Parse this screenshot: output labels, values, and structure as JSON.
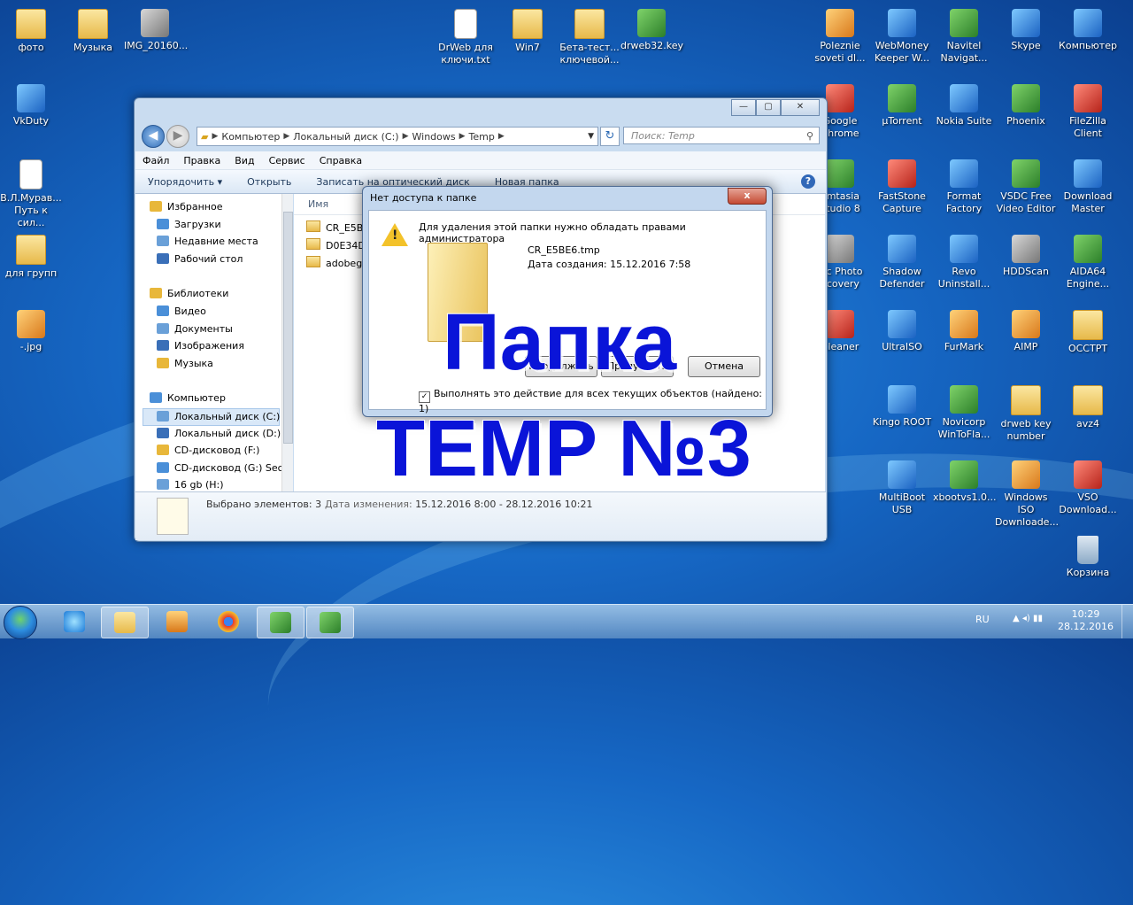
{
  "desktop_icons": [
    {
      "label": "фото",
      "kind": "folder"
    },
    {
      "label": "Музыка",
      "kind": "folder"
    },
    {
      "label": "IMG_20160...",
      "kind": "appg"
    },
    {
      "label": "DrWeb для ключи.txt",
      "kind": "doc"
    },
    {
      "label": "Win7",
      "kind": "folder"
    },
    {
      "label": "Бета-тест... ключевой...",
      "kind": "folder"
    },
    {
      "label": "drweb32.key",
      "kind": "app"
    },
    {
      "label": "VkDuty",
      "kind": "appb"
    },
    {
      "label": "В.Л.Мурав... Путь к сил...",
      "kind": "doc"
    },
    {
      "label": "для групп",
      "kind": "folder"
    },
    {
      "label": "-.jpg",
      "kind": "appo"
    },
    {
      "label": "Polezniе soveti dl...",
      "kind": "appo"
    },
    {
      "label": "WebMoney Keeper W...",
      "kind": "appb"
    },
    {
      "label": "Navitel Navigat...",
      "kind": "app"
    },
    {
      "label": "Skype",
      "kind": "appb"
    },
    {
      "label": "Компьютер",
      "kind": "appb"
    },
    {
      "label": "Google Chrome",
      "kind": "appr"
    },
    {
      "label": "µTorrent",
      "kind": "app"
    },
    {
      "label": "Nokia Suite",
      "kind": "appb"
    },
    {
      "label": "Phoenix",
      "kind": "app"
    },
    {
      "label": "FileZilla Client",
      "kind": "appr"
    },
    {
      "label": "amtasia Studio 8",
      "kind": "app"
    },
    {
      "label": "FastStone Capture",
      "kind": "appr"
    },
    {
      "label": "Format Factory",
      "kind": "appb"
    },
    {
      "label": "VSDC Free Video Editor",
      "kind": "app"
    },
    {
      "label": "Download Master",
      "kind": "appb"
    },
    {
      "label": "gic Photo ecovery",
      "kind": "appg"
    },
    {
      "label": "Shadow Defender",
      "kind": "appb"
    },
    {
      "label": "Revo Uninstall...",
      "kind": "appb"
    },
    {
      "label": "HDDScan",
      "kind": "appg"
    },
    {
      "label": "AIDA64 Engine...",
      "kind": "app"
    },
    {
      "label": "Cleaner",
      "kind": "appr"
    },
    {
      "label": "UltraISO",
      "kind": "appb"
    },
    {
      "label": "FurMark",
      "kind": "appo"
    },
    {
      "label": "AIMP",
      "kind": "appo"
    },
    {
      "label": "OCCTPT",
      "kind": "folder"
    },
    {
      "label": "Kingo ROOT",
      "kind": "appb"
    },
    {
      "label": "Novicorp WinToFla...",
      "kind": "app"
    },
    {
      "label": "drweb key number",
      "kind": "folder"
    },
    {
      "label": "avz4",
      "kind": "folder"
    },
    {
      "label": "MultiBoot USB",
      "kind": "appb"
    },
    {
      "label": "xbootvs1.0...",
      "kind": "app"
    },
    {
      "label": "Windows ISO Downloade...",
      "kind": "appo"
    },
    {
      "label": "VSO Download...",
      "kind": "appr"
    },
    {
      "label": "Корзина",
      "kind": "bin"
    }
  ],
  "explorer": {
    "controls": {
      "minimize": "—",
      "maximize": "▢",
      "close": "✕"
    },
    "nav": {
      "back": "◀",
      "forward": "▶",
      "refresh": "↻"
    },
    "breadcrumb": [
      "Компьютер",
      "Локальный диск (C:)",
      "Windows",
      "Temp"
    ],
    "search_placeholder": "Поиск: Temp",
    "menu": [
      "Файл",
      "Правка",
      "Вид",
      "Сервис",
      "Справка"
    ],
    "commands": [
      "Упорядочить ▾",
      "Открыть",
      "Записать на оптический диск",
      "Новая папка"
    ],
    "help": "?",
    "nav_pane": [
      {
        "label": "Избранное",
        "level": 0
      },
      {
        "label": "Загрузки",
        "level": 1
      },
      {
        "label": "Недавние места",
        "level": 1
      },
      {
        "label": "Рабочий стол",
        "level": 1
      },
      {
        "label": "Библиотеки",
        "level": 0
      },
      {
        "label": "Видео",
        "level": 1
      },
      {
        "label": "Документы",
        "level": 1
      },
      {
        "label": "Изображения",
        "level": 1
      },
      {
        "label": "Музыка",
        "level": 1
      },
      {
        "label": "Компьютер",
        "level": 0
      },
      {
        "label": "Локальный диск (C:)",
        "level": 1,
        "selected": true
      },
      {
        "label": "Локальный диск (D:)",
        "level": 1
      },
      {
        "label": "CD-дисковод (F:)",
        "level": 1
      },
      {
        "label": "CD-дисковод (G:) Sec",
        "level": 1
      },
      {
        "label": "16 gb (H:)",
        "level": 1
      }
    ],
    "column_name": "Имя",
    "files": [
      "CR_E5BE",
      "D0E34DD",
      "adobege"
    ],
    "details": {
      "selected": "Выбрано элементов: 3",
      "date_label": "Дата изменения:",
      "date_value": "15.12.2016 8:00 - 28.12.2016 10:21"
    }
  },
  "dialog": {
    "title": "Нет доступа к папке",
    "close": "x",
    "message": "Для удаления этой папки нужно обладать правами администратора",
    "file_name": "CR_E5BE6.tmp",
    "file_date": "Дата создания: 15.12.2016 7:58",
    "button_continue": "Продолжить",
    "button_skip": "Пропустить",
    "button_cancel": "Отмена",
    "checkbox_label": "Выполнять это действие для всех текущих объектов (найдено: 1)",
    "checkbox_mark": "✓"
  },
  "overlay": {
    "line1": "Папка",
    "line2": "TEMP №3"
  },
  "taskbar": {
    "lang": "RU",
    "time": "10:29",
    "date": "28.12.2016",
    "tray_icons": "▲  ◂)  ▮▮"
  }
}
